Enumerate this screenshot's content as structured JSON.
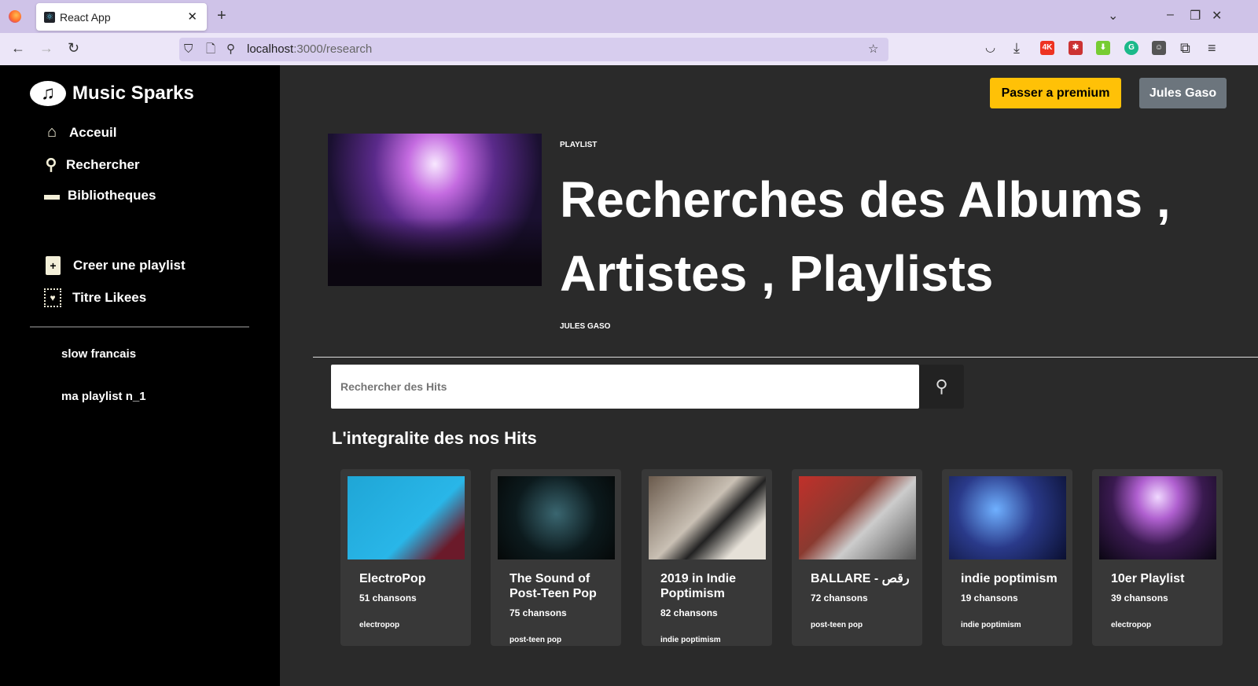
{
  "browser": {
    "tab_title": "React App",
    "url_host": "localhost",
    "url_path": ":3000/research"
  },
  "app": {
    "name": "Music Sparks"
  },
  "sidebar": {
    "nav": [
      {
        "label": "Acceuil",
        "icon": "home-icon"
      },
      {
        "label": "Rechercher",
        "icon": "search-icon"
      },
      {
        "label": "Bibliotheques",
        "icon": "library-icon"
      }
    ],
    "actions": [
      {
        "label": "Creer une playlist",
        "icon": "plus-icon"
      },
      {
        "label": "Titre Likees",
        "icon": "heart-icon"
      }
    ],
    "playlists": [
      "slow francais",
      "ma playlist n_1"
    ]
  },
  "header": {
    "premium_label": "Passer a premium",
    "user_label": "Jules Gaso"
  },
  "hero": {
    "type": "PLAYLIST",
    "title": "Recherches des Albums , Artistes , Playlists",
    "owner": "JULES GASO"
  },
  "search": {
    "placeholder": "Rechercher des Hits"
  },
  "section_title": "L'integralite des nos Hits",
  "cards": [
    {
      "title": "ElectroPop",
      "count": "51 chansons",
      "genre": "electropop"
    },
    {
      "title": "The Sound of Post-Teen Pop",
      "count": "75 chansons",
      "genre": "post-teen pop"
    },
    {
      "title": "2019 in Indie Poptimism",
      "count": "82 chansons",
      "genre": "indie poptimism"
    },
    {
      "title": "BALLARE - رقص",
      "count": "72 chansons",
      "genre": "post-teen pop"
    },
    {
      "title": "indie poptimism",
      "count": "19 chansons",
      "genre": "indie poptimism"
    },
    {
      "title": "10er Playlist",
      "count": "39 chansons",
      "genre": "electropop"
    }
  ]
}
